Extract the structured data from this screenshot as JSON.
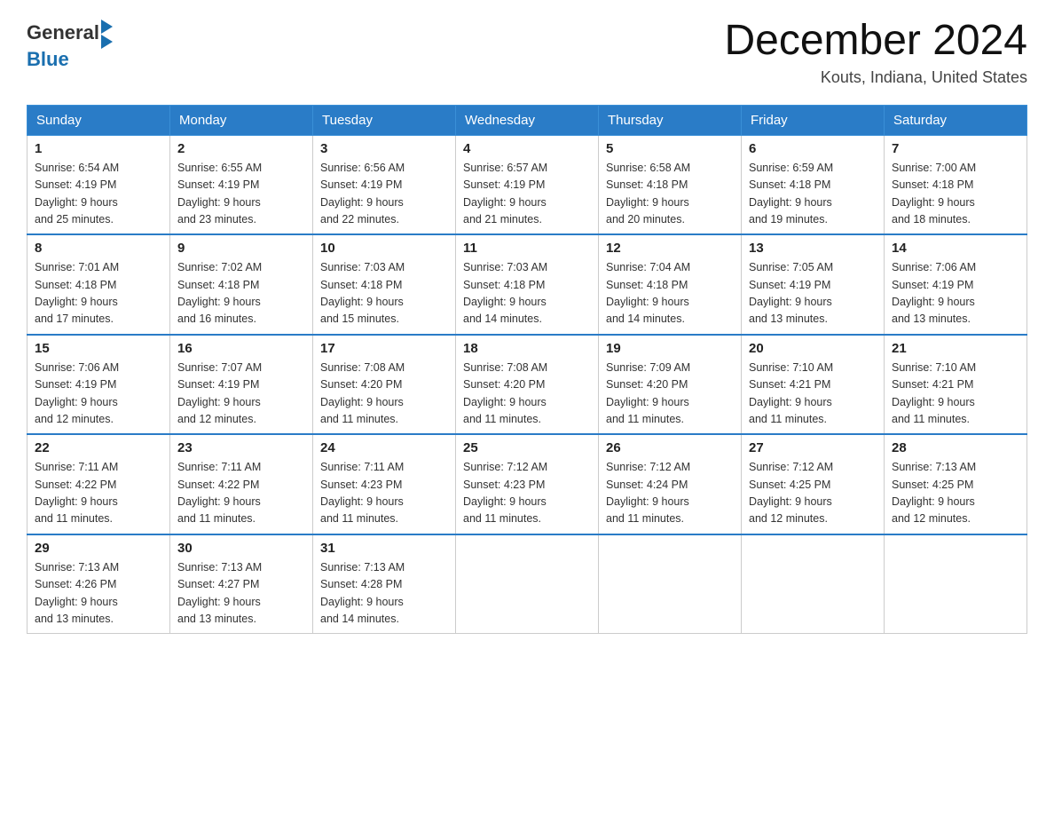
{
  "header": {
    "logo_general": "General",
    "logo_blue": "Blue",
    "month_title": "December 2024",
    "location": "Kouts, Indiana, United States"
  },
  "weekdays": [
    "Sunday",
    "Monday",
    "Tuesday",
    "Wednesday",
    "Thursday",
    "Friday",
    "Saturday"
  ],
  "weeks": [
    [
      {
        "day": "1",
        "sunrise": "6:54 AM",
        "sunset": "4:19 PM",
        "daylight": "9 hours and 25 minutes."
      },
      {
        "day": "2",
        "sunrise": "6:55 AM",
        "sunset": "4:19 PM",
        "daylight": "9 hours and 23 minutes."
      },
      {
        "day": "3",
        "sunrise": "6:56 AM",
        "sunset": "4:19 PM",
        "daylight": "9 hours and 22 minutes."
      },
      {
        "day": "4",
        "sunrise": "6:57 AM",
        "sunset": "4:19 PM",
        "daylight": "9 hours and 21 minutes."
      },
      {
        "day": "5",
        "sunrise": "6:58 AM",
        "sunset": "4:18 PM",
        "daylight": "9 hours and 20 minutes."
      },
      {
        "day": "6",
        "sunrise": "6:59 AM",
        "sunset": "4:18 PM",
        "daylight": "9 hours and 19 minutes."
      },
      {
        "day": "7",
        "sunrise": "7:00 AM",
        "sunset": "4:18 PM",
        "daylight": "9 hours and 18 minutes."
      }
    ],
    [
      {
        "day": "8",
        "sunrise": "7:01 AM",
        "sunset": "4:18 PM",
        "daylight": "9 hours and 17 minutes."
      },
      {
        "day": "9",
        "sunrise": "7:02 AM",
        "sunset": "4:18 PM",
        "daylight": "9 hours and 16 minutes."
      },
      {
        "day": "10",
        "sunrise": "7:03 AM",
        "sunset": "4:18 PM",
        "daylight": "9 hours and 15 minutes."
      },
      {
        "day": "11",
        "sunrise": "7:03 AM",
        "sunset": "4:18 PM",
        "daylight": "9 hours and 14 minutes."
      },
      {
        "day": "12",
        "sunrise": "7:04 AM",
        "sunset": "4:18 PM",
        "daylight": "9 hours and 14 minutes."
      },
      {
        "day": "13",
        "sunrise": "7:05 AM",
        "sunset": "4:19 PM",
        "daylight": "9 hours and 13 minutes."
      },
      {
        "day": "14",
        "sunrise": "7:06 AM",
        "sunset": "4:19 PM",
        "daylight": "9 hours and 13 minutes."
      }
    ],
    [
      {
        "day": "15",
        "sunrise": "7:06 AM",
        "sunset": "4:19 PM",
        "daylight": "9 hours and 12 minutes."
      },
      {
        "day": "16",
        "sunrise": "7:07 AM",
        "sunset": "4:19 PM",
        "daylight": "9 hours and 12 minutes."
      },
      {
        "day": "17",
        "sunrise": "7:08 AM",
        "sunset": "4:20 PM",
        "daylight": "9 hours and 11 minutes."
      },
      {
        "day": "18",
        "sunrise": "7:08 AM",
        "sunset": "4:20 PM",
        "daylight": "9 hours and 11 minutes."
      },
      {
        "day": "19",
        "sunrise": "7:09 AM",
        "sunset": "4:20 PM",
        "daylight": "9 hours and 11 minutes."
      },
      {
        "day": "20",
        "sunrise": "7:10 AM",
        "sunset": "4:21 PM",
        "daylight": "9 hours and 11 minutes."
      },
      {
        "day": "21",
        "sunrise": "7:10 AM",
        "sunset": "4:21 PM",
        "daylight": "9 hours and 11 minutes."
      }
    ],
    [
      {
        "day": "22",
        "sunrise": "7:11 AM",
        "sunset": "4:22 PM",
        "daylight": "9 hours and 11 minutes."
      },
      {
        "day": "23",
        "sunrise": "7:11 AM",
        "sunset": "4:22 PM",
        "daylight": "9 hours and 11 minutes."
      },
      {
        "day": "24",
        "sunrise": "7:11 AM",
        "sunset": "4:23 PM",
        "daylight": "9 hours and 11 minutes."
      },
      {
        "day": "25",
        "sunrise": "7:12 AM",
        "sunset": "4:23 PM",
        "daylight": "9 hours and 11 minutes."
      },
      {
        "day": "26",
        "sunrise": "7:12 AM",
        "sunset": "4:24 PM",
        "daylight": "9 hours and 11 minutes."
      },
      {
        "day": "27",
        "sunrise": "7:12 AM",
        "sunset": "4:25 PM",
        "daylight": "9 hours and 12 minutes."
      },
      {
        "day": "28",
        "sunrise": "7:13 AM",
        "sunset": "4:25 PM",
        "daylight": "9 hours and 12 minutes."
      }
    ],
    [
      {
        "day": "29",
        "sunrise": "7:13 AM",
        "sunset": "4:26 PM",
        "daylight": "9 hours and 13 minutes."
      },
      {
        "day": "30",
        "sunrise": "7:13 AM",
        "sunset": "4:27 PM",
        "daylight": "9 hours and 13 minutes."
      },
      {
        "day": "31",
        "sunrise": "7:13 AM",
        "sunset": "4:28 PM",
        "daylight": "9 hours and 14 minutes."
      },
      null,
      null,
      null,
      null
    ]
  ],
  "labels": {
    "sunrise": "Sunrise:",
    "sunset": "Sunset:",
    "daylight": "Daylight:"
  }
}
